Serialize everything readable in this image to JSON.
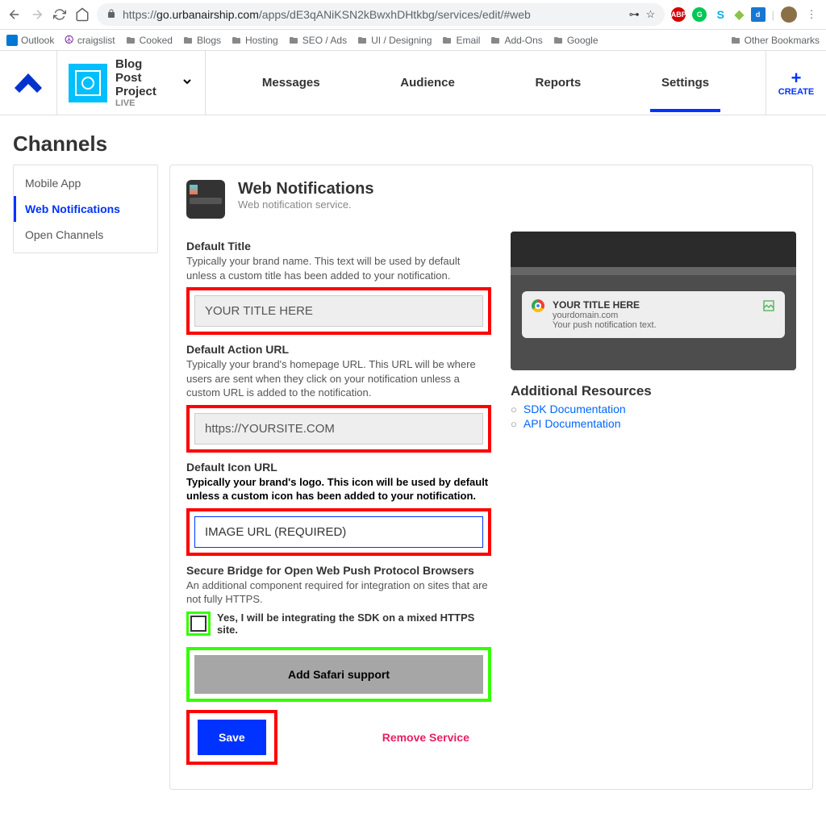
{
  "browser": {
    "url_prefix": "https://",
    "url_host": "go.urbanairship.com",
    "url_path": "/apps/dE3qANiKSN2kBwxhDHtkbg/services/edit/#web",
    "extensions": [
      "ABP",
      "G",
      "S",
      "d"
    ]
  },
  "bookmarks": {
    "items": [
      "Outlook",
      "craigslist",
      "Cooked",
      "Blogs",
      "Hosting",
      "SEO / Ads",
      "UI / Designing",
      "Email",
      "Add-Ons",
      "Google"
    ],
    "other": "Other Bookmarks"
  },
  "header": {
    "project_line1": "Blog",
    "project_line2": "Post",
    "project_line3": "Project",
    "project_status": "LIVE",
    "tabs": [
      "Messages",
      "Audience",
      "Reports",
      "Settings"
    ],
    "create": "CREATE"
  },
  "page": {
    "title": "Channels",
    "sidebar": [
      "Mobile App",
      "Web Notifications",
      "Open Channels"
    ],
    "panel_title": "Web Notifications",
    "panel_sub": "Web notification service.",
    "f1_label": "Default Title",
    "f1_help": "Typically your brand name. This text will be used by default unless a custom title has been added to your notification.",
    "f1_value": "YOUR TITLE HERE",
    "f2_label": "Default Action URL",
    "f2_help": "Typically your brand's homepage URL. This URL will be where users are sent when they click on your notification unless a custom URL is added to the notification.",
    "f2_value": "https://YOURSITE.COM",
    "f3_label": "Default Icon URL",
    "f3_help": "Typically your brand's logo. This icon will be used by default unless a custom icon has been added to your notification.",
    "f3_value": "IMAGE URL (REQUIRED)",
    "f4_label": "Secure Bridge for Open Web Push Protocol Browsers",
    "f4_help": "An additional component required for integration on sites that are not fully HTTPS.",
    "f4_check": "Yes, I will be integrating the SDK on a mixed HTTPS site.",
    "safari_btn": "Add Safari support",
    "save_btn": "Save",
    "remove": "Remove Service",
    "preview": {
      "title": "YOUR TITLE HERE",
      "domain": "yourdomain.com",
      "body": "Your push notification text."
    },
    "res_title": "Additional Resources",
    "res_links": [
      "SDK Documentation",
      "API Documentation"
    ]
  }
}
